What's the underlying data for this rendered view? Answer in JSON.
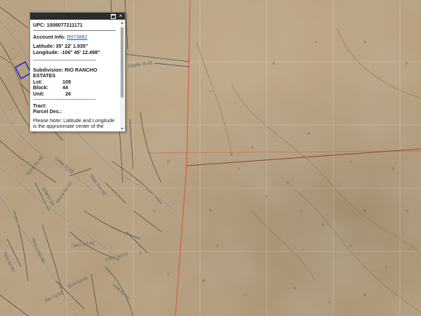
{
  "map": {
    "street_labels": [
      "Dilaria Ct NE",
      "Ceres St NE",
      "Atlas Ave NE",
      "Ariel Dr NE",
      "Adobe Rd NE",
      "Pima Loop NE",
      "Caslo Rd NE",
      "Orion Rd NE",
      "Taos Rd NE",
      "Zuni Rd NE",
      "Luna Rd NE",
      "Rex Rd NE",
      "Yucca Rd NE"
    ]
  },
  "popup": {
    "upc_label": "UPC:",
    "upc_value": "1008077211171",
    "account_label": "Account Info:",
    "account_value": "R073882",
    "latitude_label": "Latitude:",
    "latitude_value": "35° 22' 1.935\"",
    "longitude_label": "Longitude:",
    "longitude_value": "-106° 45' 12.498\"",
    "separator": "-----------------------------------------",
    "subdivision_label": "Subdivision:",
    "subdivision_value": "RIO RANCHO ESTATES",
    "lot_label": "Lot:",
    "lot_value": "108",
    "block_label": "Block:",
    "block_value": "44",
    "unit_label": "Unit:",
    "unit_value": "26",
    "tract_label": "Tract:",
    "parcel_label": "Parcel Des.:",
    "note": "Please Note: Latitude and Longitude is the approximate center of the parcel shown.",
    "maximize_icon": "maximize-icon",
    "close_icon": "close-icon",
    "close_glyph": "×"
  },
  "colors": {
    "terrain": "#b39a77",
    "parcel_line": "#d65a3a",
    "road_line": "#3a3a3a",
    "selected_parcel": "#1f2bd6"
  }
}
